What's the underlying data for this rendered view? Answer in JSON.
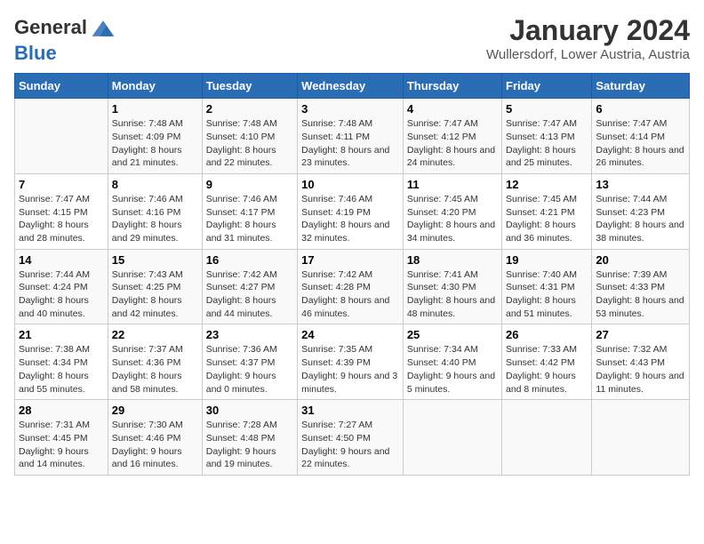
{
  "logo": {
    "line1": "General",
    "line2": "Blue"
  },
  "title": "January 2024",
  "subtitle": "Wullersdorf, Lower Austria, Austria",
  "days_of_week": [
    "Sunday",
    "Monday",
    "Tuesday",
    "Wednesday",
    "Thursday",
    "Friday",
    "Saturday"
  ],
  "weeks": [
    [
      {
        "num": "",
        "sunrise": "",
        "sunset": "",
        "daylight": ""
      },
      {
        "num": "1",
        "sunrise": "Sunrise: 7:48 AM",
        "sunset": "Sunset: 4:09 PM",
        "daylight": "Daylight: 8 hours and 21 minutes."
      },
      {
        "num": "2",
        "sunrise": "Sunrise: 7:48 AM",
        "sunset": "Sunset: 4:10 PM",
        "daylight": "Daylight: 8 hours and 22 minutes."
      },
      {
        "num": "3",
        "sunrise": "Sunrise: 7:48 AM",
        "sunset": "Sunset: 4:11 PM",
        "daylight": "Daylight: 8 hours and 23 minutes."
      },
      {
        "num": "4",
        "sunrise": "Sunrise: 7:47 AM",
        "sunset": "Sunset: 4:12 PM",
        "daylight": "Daylight: 8 hours and 24 minutes."
      },
      {
        "num": "5",
        "sunrise": "Sunrise: 7:47 AM",
        "sunset": "Sunset: 4:13 PM",
        "daylight": "Daylight: 8 hours and 25 minutes."
      },
      {
        "num": "6",
        "sunrise": "Sunrise: 7:47 AM",
        "sunset": "Sunset: 4:14 PM",
        "daylight": "Daylight: 8 hours and 26 minutes."
      }
    ],
    [
      {
        "num": "7",
        "sunrise": "Sunrise: 7:47 AM",
        "sunset": "Sunset: 4:15 PM",
        "daylight": "Daylight: 8 hours and 28 minutes."
      },
      {
        "num": "8",
        "sunrise": "Sunrise: 7:46 AM",
        "sunset": "Sunset: 4:16 PM",
        "daylight": "Daylight: 8 hours and 29 minutes."
      },
      {
        "num": "9",
        "sunrise": "Sunrise: 7:46 AM",
        "sunset": "Sunset: 4:17 PM",
        "daylight": "Daylight: 8 hours and 31 minutes."
      },
      {
        "num": "10",
        "sunrise": "Sunrise: 7:46 AM",
        "sunset": "Sunset: 4:19 PM",
        "daylight": "Daylight: 8 hours and 32 minutes."
      },
      {
        "num": "11",
        "sunrise": "Sunrise: 7:45 AM",
        "sunset": "Sunset: 4:20 PM",
        "daylight": "Daylight: 8 hours and 34 minutes."
      },
      {
        "num": "12",
        "sunrise": "Sunrise: 7:45 AM",
        "sunset": "Sunset: 4:21 PM",
        "daylight": "Daylight: 8 hours and 36 minutes."
      },
      {
        "num": "13",
        "sunrise": "Sunrise: 7:44 AM",
        "sunset": "Sunset: 4:23 PM",
        "daylight": "Daylight: 8 hours and 38 minutes."
      }
    ],
    [
      {
        "num": "14",
        "sunrise": "Sunrise: 7:44 AM",
        "sunset": "Sunset: 4:24 PM",
        "daylight": "Daylight: 8 hours and 40 minutes."
      },
      {
        "num": "15",
        "sunrise": "Sunrise: 7:43 AM",
        "sunset": "Sunset: 4:25 PM",
        "daylight": "Daylight: 8 hours and 42 minutes."
      },
      {
        "num": "16",
        "sunrise": "Sunrise: 7:42 AM",
        "sunset": "Sunset: 4:27 PM",
        "daylight": "Daylight: 8 hours and 44 minutes."
      },
      {
        "num": "17",
        "sunrise": "Sunrise: 7:42 AM",
        "sunset": "Sunset: 4:28 PM",
        "daylight": "Daylight: 8 hours and 46 minutes."
      },
      {
        "num": "18",
        "sunrise": "Sunrise: 7:41 AM",
        "sunset": "Sunset: 4:30 PM",
        "daylight": "Daylight: 8 hours and 48 minutes."
      },
      {
        "num": "19",
        "sunrise": "Sunrise: 7:40 AM",
        "sunset": "Sunset: 4:31 PM",
        "daylight": "Daylight: 8 hours and 51 minutes."
      },
      {
        "num": "20",
        "sunrise": "Sunrise: 7:39 AM",
        "sunset": "Sunset: 4:33 PM",
        "daylight": "Daylight: 8 hours and 53 minutes."
      }
    ],
    [
      {
        "num": "21",
        "sunrise": "Sunrise: 7:38 AM",
        "sunset": "Sunset: 4:34 PM",
        "daylight": "Daylight: 8 hours and 55 minutes."
      },
      {
        "num": "22",
        "sunrise": "Sunrise: 7:37 AM",
        "sunset": "Sunset: 4:36 PM",
        "daylight": "Daylight: 8 hours and 58 minutes."
      },
      {
        "num": "23",
        "sunrise": "Sunrise: 7:36 AM",
        "sunset": "Sunset: 4:37 PM",
        "daylight": "Daylight: 9 hours and 0 minutes."
      },
      {
        "num": "24",
        "sunrise": "Sunrise: 7:35 AM",
        "sunset": "Sunset: 4:39 PM",
        "daylight": "Daylight: 9 hours and 3 minutes."
      },
      {
        "num": "25",
        "sunrise": "Sunrise: 7:34 AM",
        "sunset": "Sunset: 4:40 PM",
        "daylight": "Daylight: 9 hours and 5 minutes."
      },
      {
        "num": "26",
        "sunrise": "Sunrise: 7:33 AM",
        "sunset": "Sunset: 4:42 PM",
        "daylight": "Daylight: 9 hours and 8 minutes."
      },
      {
        "num": "27",
        "sunrise": "Sunrise: 7:32 AM",
        "sunset": "Sunset: 4:43 PM",
        "daylight": "Daylight: 9 hours and 11 minutes."
      }
    ],
    [
      {
        "num": "28",
        "sunrise": "Sunrise: 7:31 AM",
        "sunset": "Sunset: 4:45 PM",
        "daylight": "Daylight: 9 hours and 14 minutes."
      },
      {
        "num": "29",
        "sunrise": "Sunrise: 7:30 AM",
        "sunset": "Sunset: 4:46 PM",
        "daylight": "Daylight: 9 hours and 16 minutes."
      },
      {
        "num": "30",
        "sunrise": "Sunrise: 7:28 AM",
        "sunset": "Sunset: 4:48 PM",
        "daylight": "Daylight: 9 hours and 19 minutes."
      },
      {
        "num": "31",
        "sunrise": "Sunrise: 7:27 AM",
        "sunset": "Sunset: 4:50 PM",
        "daylight": "Daylight: 9 hours and 22 minutes."
      },
      {
        "num": "",
        "sunrise": "",
        "sunset": "",
        "daylight": ""
      },
      {
        "num": "",
        "sunrise": "",
        "sunset": "",
        "daylight": ""
      },
      {
        "num": "",
        "sunrise": "",
        "sunset": "",
        "daylight": ""
      }
    ]
  ]
}
